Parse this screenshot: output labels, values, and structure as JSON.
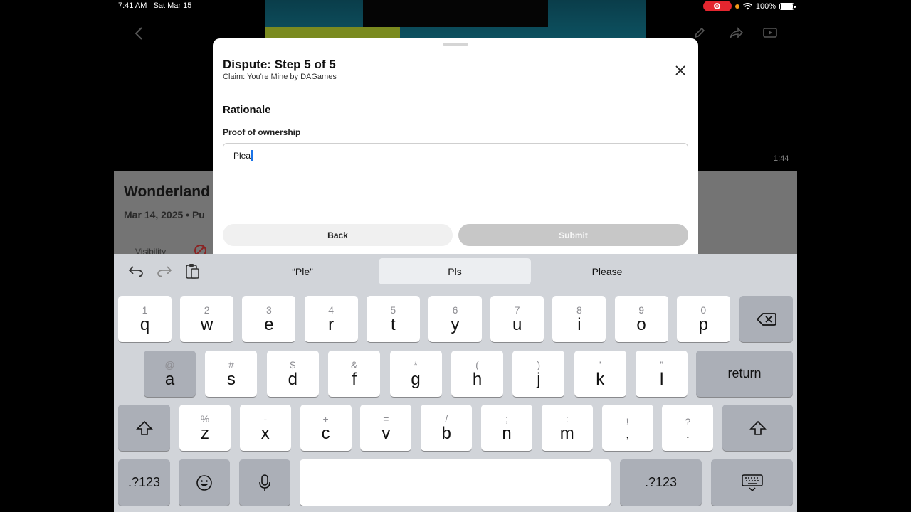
{
  "status_bar": {
    "time": "7:41 AM",
    "date": "Sat Mar 15",
    "battery": "100%"
  },
  "background": {
    "duration": "1:44",
    "title": "Wonderland",
    "meta": "Mar 14, 2025 • Pu",
    "visibility_label": "Visibility"
  },
  "dialog": {
    "title": "Dispute: Step 5 of 5",
    "subtitle": "Claim: You're Mine by DAGames",
    "section_title": "Rationale",
    "field_label": "Proof of ownership",
    "field_value": "Plea",
    "back_label": "Back",
    "submit_label": "Submit"
  },
  "keyboard": {
    "suggestions": [
      "“Ple”",
      "Pls",
      "Please"
    ],
    "selected_suggestion": "Pls",
    "row1": [
      {
        "sec": "1",
        "pri": "q"
      },
      {
        "sec": "2",
        "pri": "w"
      },
      {
        "sec": "3",
        "pri": "e"
      },
      {
        "sec": "4",
        "pri": "r"
      },
      {
        "sec": "5",
        "pri": "t"
      },
      {
        "sec": "6",
        "pri": "y"
      },
      {
        "sec": "7",
        "pri": "u"
      },
      {
        "sec": "8",
        "pri": "i"
      },
      {
        "sec": "9",
        "pri": "o"
      },
      {
        "sec": "0",
        "pri": "p"
      }
    ],
    "row2": [
      {
        "sec": "@",
        "pri": "a"
      },
      {
        "sec": "#",
        "pri": "s"
      },
      {
        "sec": "$",
        "pri": "d"
      },
      {
        "sec": "&",
        "pri": "f"
      },
      {
        "sec": "*",
        "pri": "g"
      },
      {
        "sec": "(",
        "pri": "h"
      },
      {
        "sec": ")",
        "pri": "j"
      },
      {
        "sec": "’",
        "pri": "k"
      },
      {
        "sec": "”",
        "pri": "l"
      }
    ],
    "row3": [
      {
        "sec": "%",
        "pri": "z"
      },
      {
        "sec": "-",
        "pri": "x"
      },
      {
        "sec": "+",
        "pri": "c"
      },
      {
        "sec": "=",
        "pri": "v"
      },
      {
        "sec": "/",
        "pri": "b"
      },
      {
        "sec": ";",
        "pri": "n"
      },
      {
        "sec": ":",
        "pri": "m"
      },
      {
        "sec": "!",
        "pri": ","
      },
      {
        "sec": "?",
        "pri": "."
      }
    ],
    "return_label": "return",
    "numbers_label": ".?123",
    "pressed_key": "a"
  }
}
